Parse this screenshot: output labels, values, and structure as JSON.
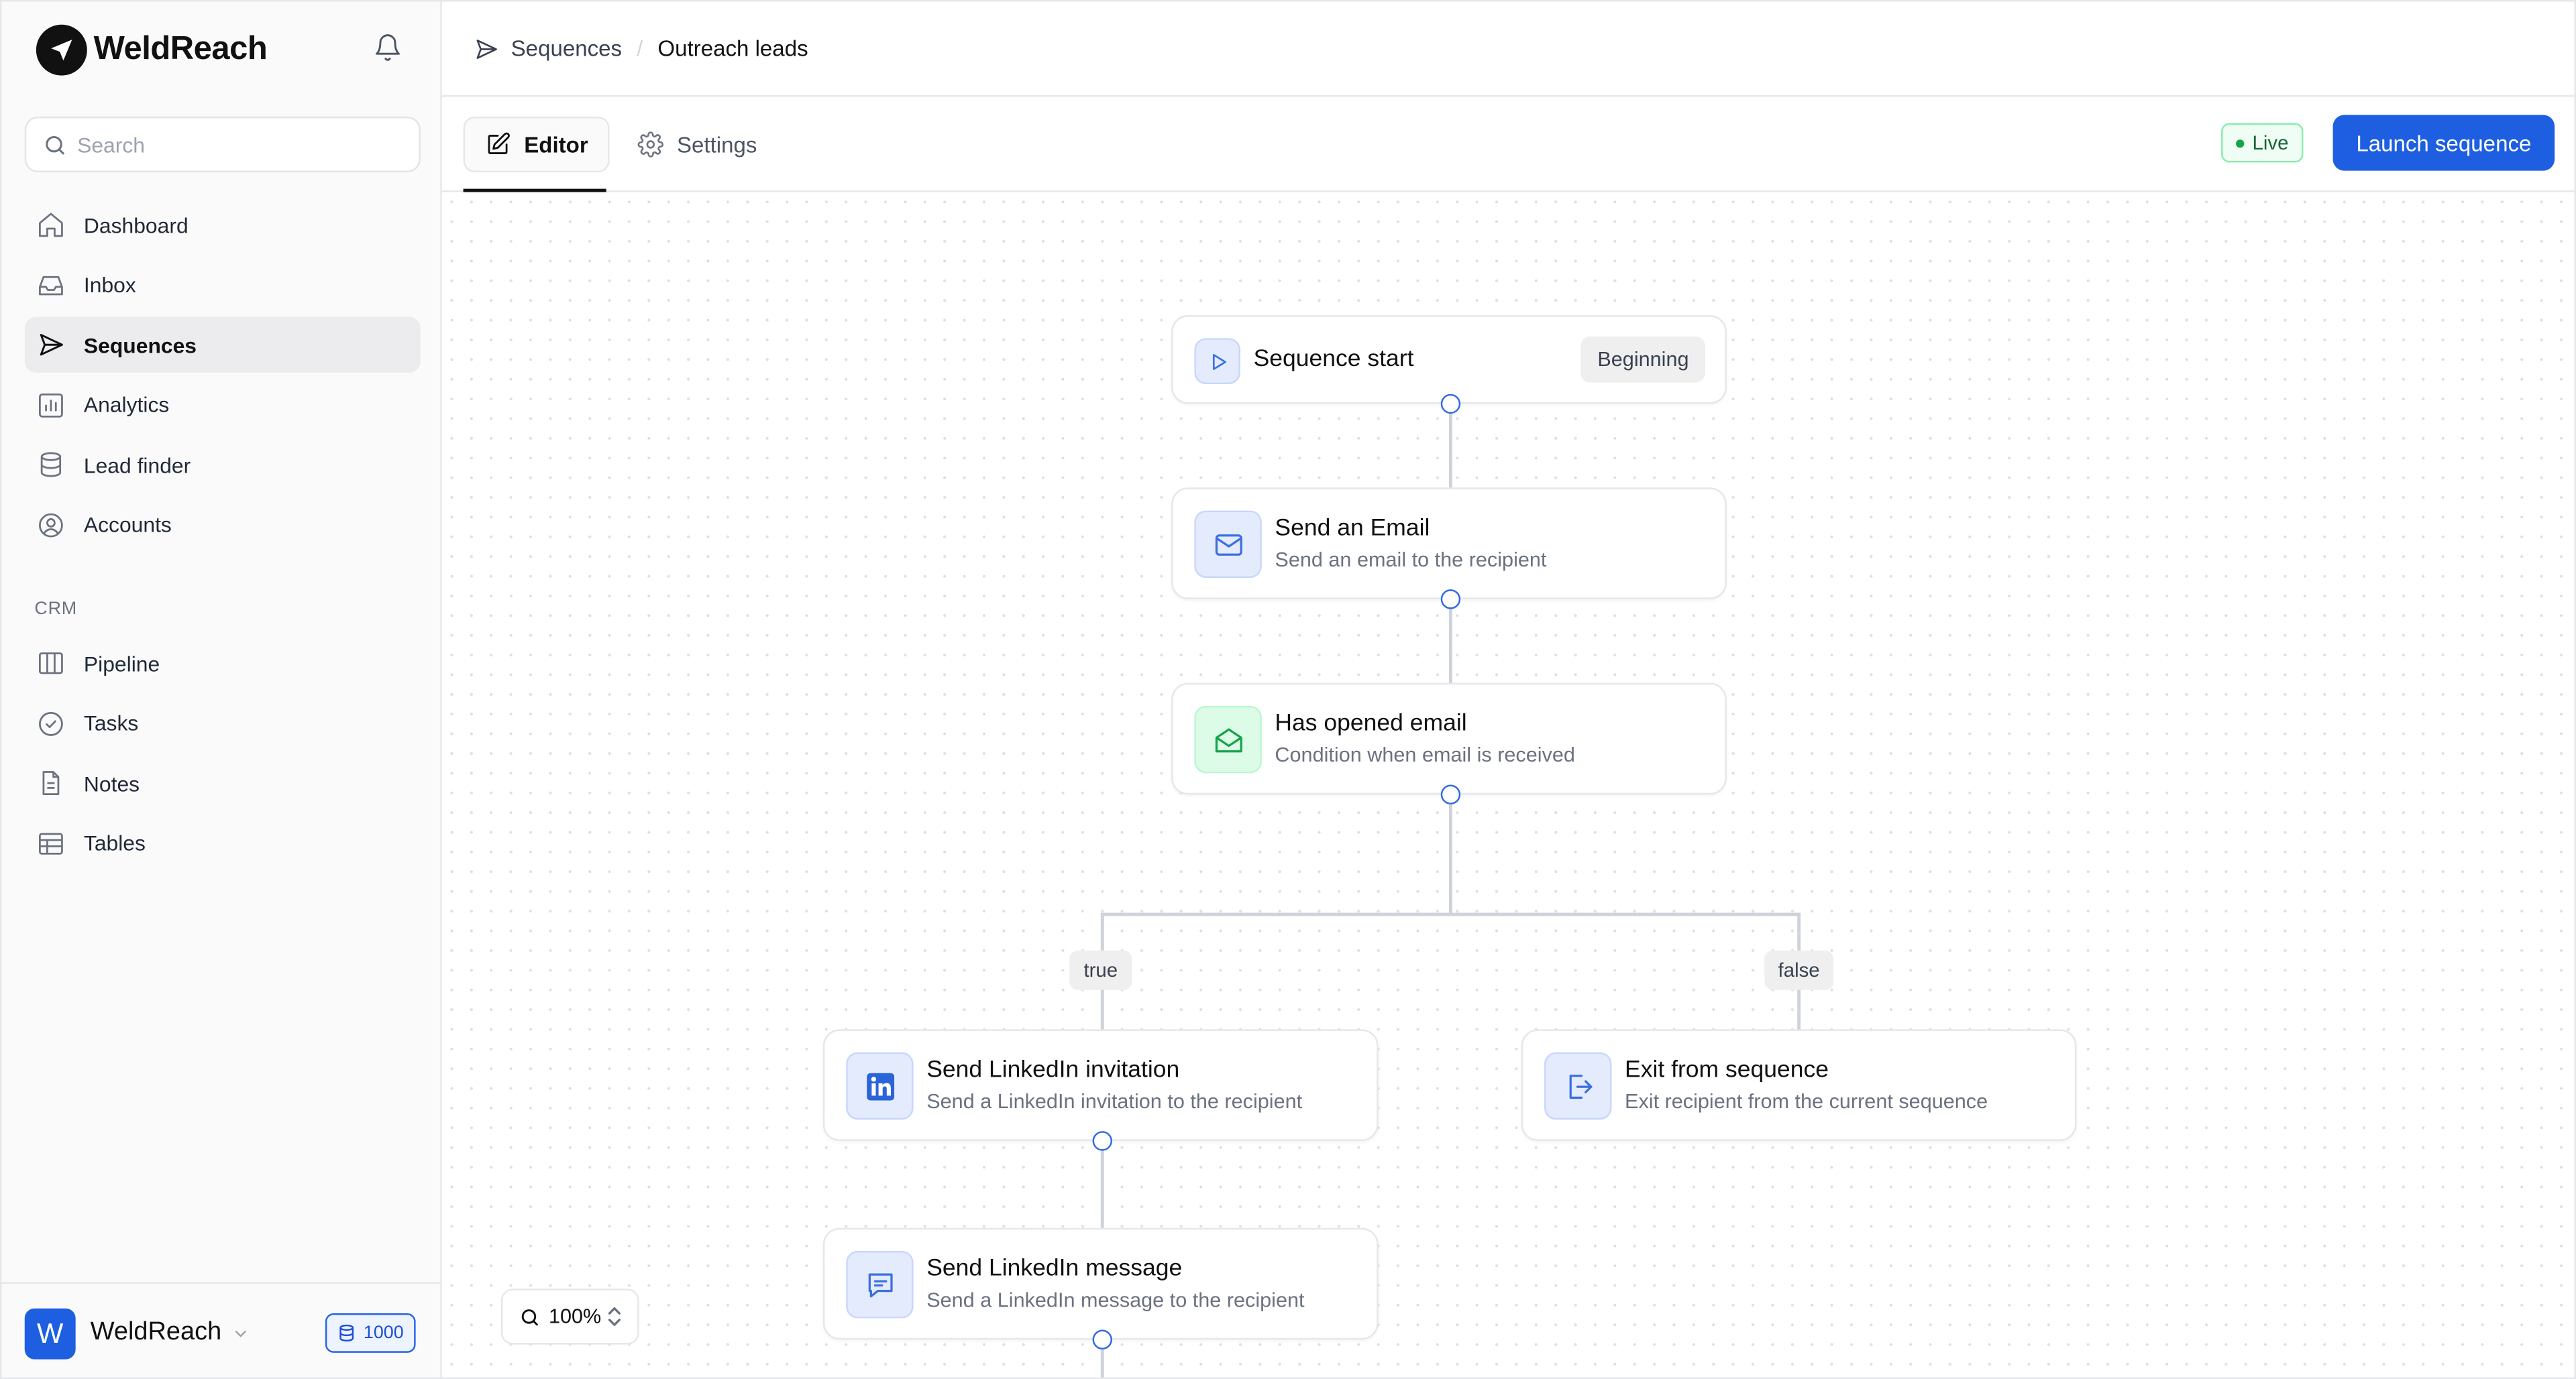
{
  "app": {
    "brand_name": "WeldReach"
  },
  "sidebar": {
    "search_placeholder": "Search",
    "nav": [
      {
        "label": "Dashboard",
        "icon": "home-icon"
      },
      {
        "label": "Inbox",
        "icon": "inbox-icon"
      },
      {
        "label": "Sequences",
        "icon": "send-icon",
        "active": true
      },
      {
        "label": "Analytics",
        "icon": "bar-chart-icon"
      },
      {
        "label": "Lead finder",
        "icon": "database-icon"
      },
      {
        "label": "Accounts",
        "icon": "user-circle-icon"
      }
    ],
    "crm_label": "CRM",
    "crm_nav": [
      {
        "label": "Pipeline",
        "icon": "columns-icon"
      },
      {
        "label": "Tasks",
        "icon": "check-circle-icon"
      },
      {
        "label": "Notes",
        "icon": "file-icon"
      },
      {
        "label": "Tables",
        "icon": "table-icon"
      }
    ],
    "workspace": {
      "avatar_letter": "W",
      "name": "WeldReach",
      "credits": "1000"
    }
  },
  "header": {
    "breadcrumb": [
      "Sequences",
      "Outreach leads"
    ]
  },
  "tabs": {
    "editor_label": "Editor",
    "settings_label": "Settings",
    "status_label": "Live",
    "launch_label": "Launch sequence"
  },
  "canvas": {
    "zoom": "100%",
    "nodes": {
      "start": {
        "title": "Sequence start",
        "badge": "Beginning"
      },
      "email": {
        "title": "Send an Email",
        "subtitle": "Send an email to the recipient"
      },
      "opened": {
        "title": "Has opened email",
        "subtitle": "Condition when email is received"
      },
      "linkedin_invite": {
        "title": "Send LinkedIn invitation",
        "subtitle": "Send a LinkedIn invitation to the recipient"
      },
      "exit": {
        "title": "Exit from sequence",
        "subtitle": "Exit recipient from the current sequence"
      },
      "linkedin_message": {
        "title": "Send LinkedIn message",
        "subtitle": "Send a LinkedIn message to the recipient"
      }
    },
    "branches": {
      "true_label": "true",
      "false_label": "false"
    }
  },
  "colors": {
    "accent": "#1d5fe0",
    "live_green": "#16a34a"
  }
}
